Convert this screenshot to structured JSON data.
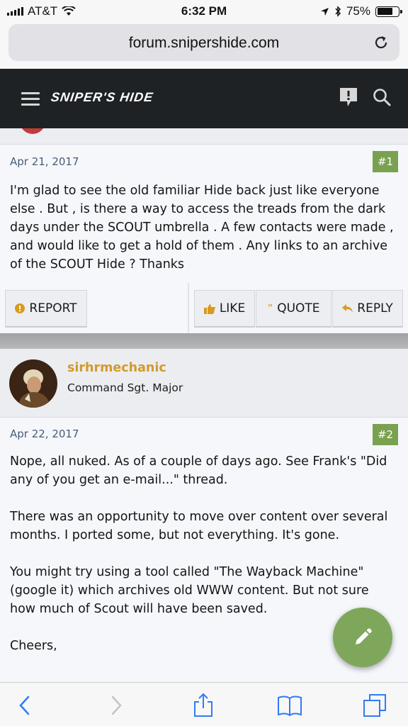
{
  "status_bar": {
    "carrier": "AT&T",
    "time": "6:32 PM",
    "battery": "75%",
    "battery_level": 0.75
  },
  "browser": {
    "url": "forum.snipershide.com"
  },
  "site": {
    "logo_text": "SNIPER'S HIDE"
  },
  "posts": [
    {
      "date": "Apr 21, 2017",
      "number": "#1",
      "paragraphs": [
        "I'm glad to see the old familiar Hide back just like everyone else . But , is there a way to access the treads from the dark days under the SCOUT umbrella . A few contacts were made , and would like to get a hold of them . Any links to an archive of the SCOUT Hide ? Thanks"
      ],
      "actions": {
        "report": "REPORT",
        "like": "LIKE",
        "quote": "QUOTE",
        "reply": "REPLY"
      }
    },
    {
      "username": "sirhrmechanic",
      "user_title": "Command Sgt. Major",
      "date": "Apr 22, 2017",
      "number": "#2",
      "paragraphs": [
        "Nope, all nuked. As of a couple of days ago. See Frank's \"Did any of you get an e-mail...\" thread.",
        "There was an opportunity to move over content over several months. I ported some, but not everything. It's gone.",
        "You might try using a tool called \"The Wayback Machine\" (google it) which archives old WWW content. But not sure how much of Scout will have been saved.",
        "Cheers,"
      ]
    }
  ],
  "colors": {
    "header_bg": "#1f2225",
    "accent_green": "#79a14f",
    "username_gold": "#d39a2b",
    "ios_blue": "#2f7cf6"
  },
  "icons": {
    "reload": "reload-icon",
    "menu": "hamburger-menu-icon",
    "alerts": "alert-bubble-icon",
    "search": "search-icon",
    "report": "warning-circle-icon",
    "like": "thumbs-up-icon",
    "quote": "quote-icon",
    "reply": "reply-arrow-icon",
    "compose": "pencil-icon",
    "back": "chevron-left-icon",
    "forward": "chevron-right-icon",
    "share": "share-icon",
    "bookmarks": "book-icon",
    "tabs": "tabs-icon"
  }
}
